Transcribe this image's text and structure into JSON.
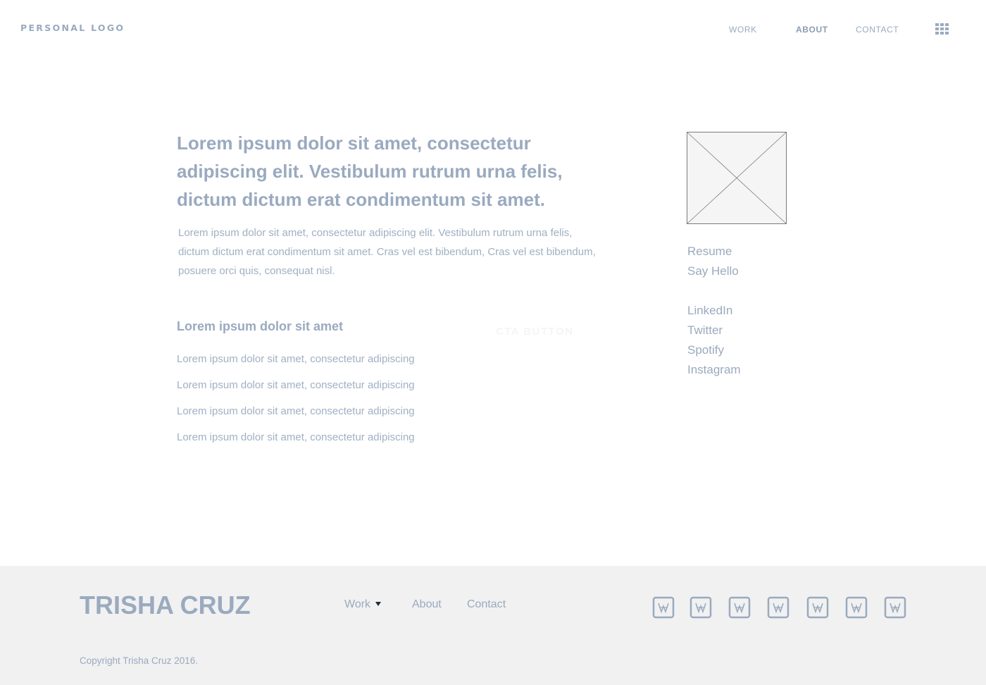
{
  "header": {
    "logo": "PERSONAL LOGO",
    "nav": [
      "WORK",
      "ABOUT",
      "CONTACT"
    ],
    "active_nav": "ABOUT",
    "menu_icon": "grid-icon"
  },
  "main": {
    "headline": "Lorem ipsum dolor sit amet, consectetur adipiscing elit. Vestibulum rutrum urna felis, dictum dictum erat condimentum sit amet.",
    "intro": "Lorem ipsum dolor sit amet, consectetur adipiscing elit. Vestibulum rutrum urna felis, dictum dictum erat condimentum sit amet. Cras vel est bibendum, Cras vel est bibendum, posuere orci quis, consequat nisl.",
    "subheading": "Lorem ipsum dolor sit amet",
    "cta_label": "CTA BUTTON",
    "list": [
      "Lorem ipsum dolor sit amet, consectetur adipiscing",
      "Lorem ipsum dolor sit amet, consectetur adipiscing",
      "Lorem ipsum dolor sit amet, consectetur adipiscing",
      "Lorem ipsum dolor sit amet, consectetur adipiscing"
    ]
  },
  "sidebar": {
    "image_placeholder": "image-placeholder-icon",
    "links_primary": [
      "Resume",
      "Say Hello"
    ],
    "links_social": [
      "LinkedIn",
      "Twitter",
      "Spotify",
      "Instagram"
    ]
  },
  "footer": {
    "name": "TRISHA CRUZ",
    "links": [
      "Work",
      "About",
      "Contact"
    ],
    "dropdown_icon": "caret-down-icon",
    "social_icons": [
      "social-icon",
      "social-icon",
      "social-icon",
      "social-icon",
      "social-icon",
      "social-icon",
      "social-icon"
    ],
    "copyright": "Copyright Trisha Cruz 2016."
  },
  "colors": {
    "text": "#96a8bd",
    "footer_bg": "#f1f1f1",
    "placeholder_bg": "#f5f5f5",
    "placeholder_stroke": "#7a7a7a"
  }
}
